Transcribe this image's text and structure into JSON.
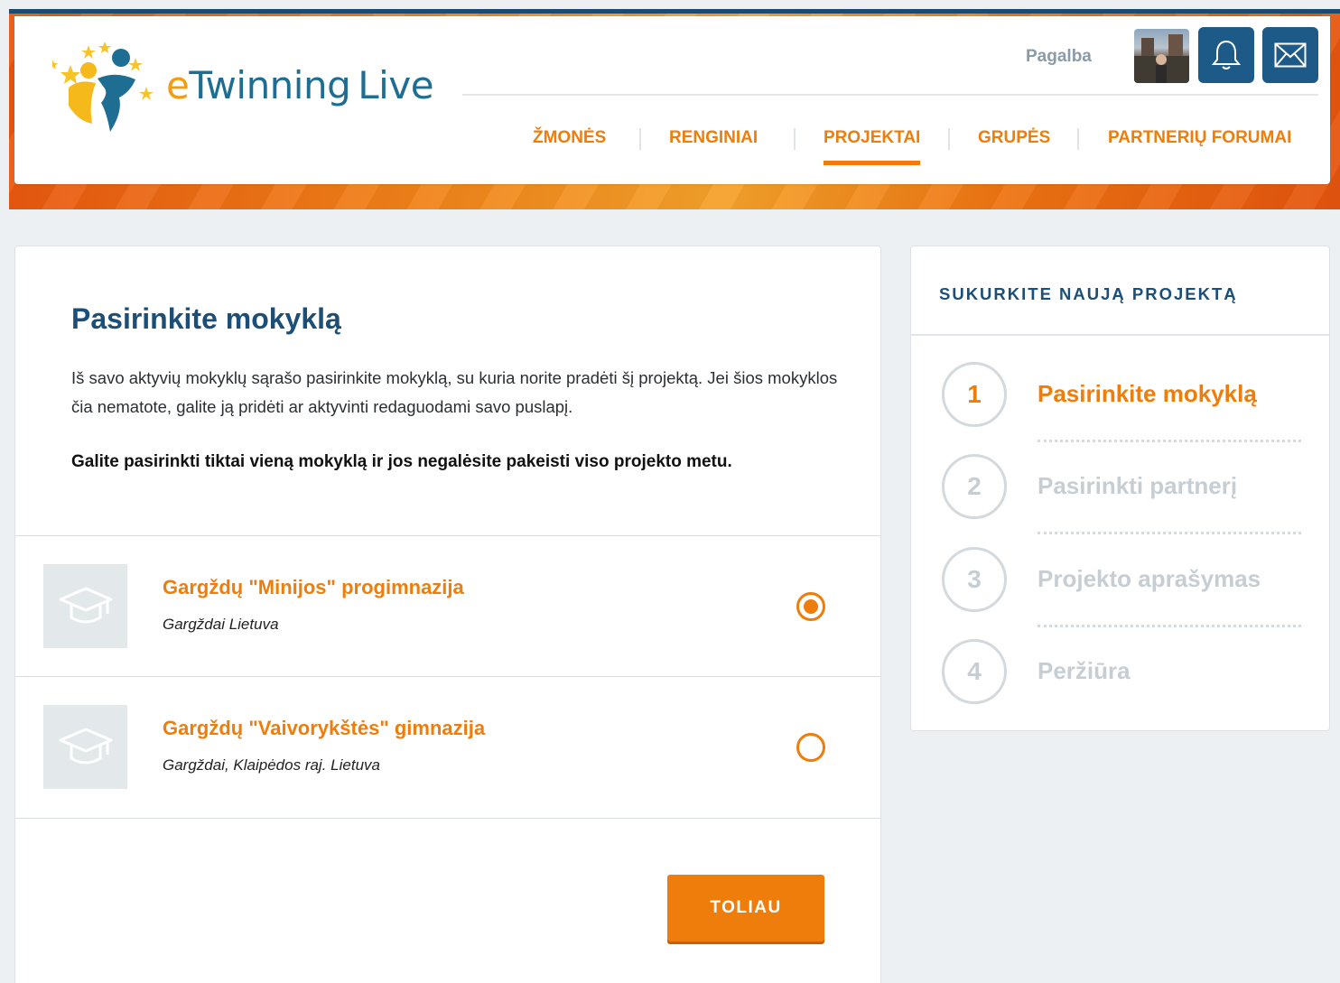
{
  "header": {
    "logo_text_e": "e",
    "logo_text_rest": "Twinning",
    "logo_text_live": "Live",
    "help_label": "Pagalba",
    "bell_icon": "bell-icon",
    "mail_icon": "envelope-icon",
    "nav": [
      {
        "label": "ŽMONĖS"
      },
      {
        "label": "RENGINIAI"
      },
      {
        "label": "PROJEKTAI",
        "active": true
      },
      {
        "label": "GRUPĖS"
      },
      {
        "label": "PARTNERIŲ FORUMAI"
      }
    ],
    "colors": {
      "accent": "#ef7d0b",
      "primary": "#1c4f78",
      "icon_button": "#1d5a87"
    }
  },
  "main": {
    "title": "Pasirinkite mokyklą",
    "description": "Iš savo aktyvių mokyklų sąrašo pasirinkite mokyklą, su kuria norite pradėti šį projektą. Jei šios mokyklos čia nematote, galite ją pridėti ar aktyvinti redaguodami savo puslapį.",
    "note": "Galite pasirinkti tiktai vieną mokyklą ir jos negalėsite pakeisti viso projekto metu.",
    "schools": [
      {
        "name": "Gargždų \"Minijos\" progimnazija",
        "location": "Gargždai Lietuva",
        "selected": true
      },
      {
        "name": "Gargždų \"Vaivorykštės\" gimnazija",
        "location": "Gargždai, Klaipėdos raj. Lietuva",
        "selected": false
      }
    ],
    "next_label": "TOLIAU"
  },
  "sidebar": {
    "title": "SUKURKITE NAUJĄ PROJEKTĄ",
    "steps": [
      {
        "number": "1",
        "label": "Pasirinkite mokyklą",
        "active": true
      },
      {
        "number": "2",
        "label": "Pasirinkti partnerį",
        "active": false
      },
      {
        "number": "3",
        "label": "Projekto aprašymas",
        "active": false
      },
      {
        "number": "4",
        "label": "Peržiūra",
        "active": false
      }
    ]
  }
}
